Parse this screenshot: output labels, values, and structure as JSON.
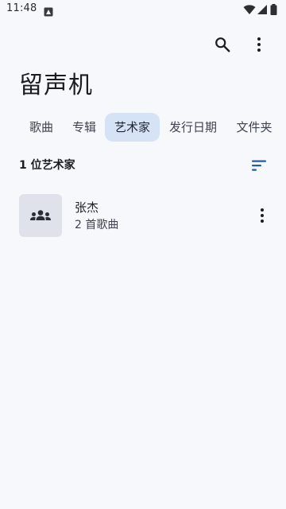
{
  "status_bar": {
    "time": "11:48",
    "icons": [
      "notification-icon",
      "wifi-icon",
      "signal-icon",
      "battery-icon"
    ]
  },
  "toolbar": {
    "icons": [
      "search-icon",
      "more-vert-icon"
    ]
  },
  "page": {
    "title": "留声机"
  },
  "tabs": {
    "selected": "艺术家",
    "items": [
      {
        "label": "歌曲"
      },
      {
        "label": "专辑"
      },
      {
        "label": "艺术家"
      },
      {
        "label": "发行日期"
      },
      {
        "label": "文件夹"
      }
    ]
  },
  "list": {
    "count_label": "1 位艺术家",
    "sort_icon": "sort-icon",
    "artists": [
      {
        "name": "张杰",
        "subtitle": "2 首歌曲",
        "thumbnail_icon": "artist-group-icon",
        "menu_icon": "more-vert-icon"
      }
    ]
  },
  "colors": {
    "background": "#f7f8fc",
    "active_tab": "#d6e3f7",
    "thumbnail_bg": "#dfe2ea",
    "accent": "#1f5ea8"
  }
}
